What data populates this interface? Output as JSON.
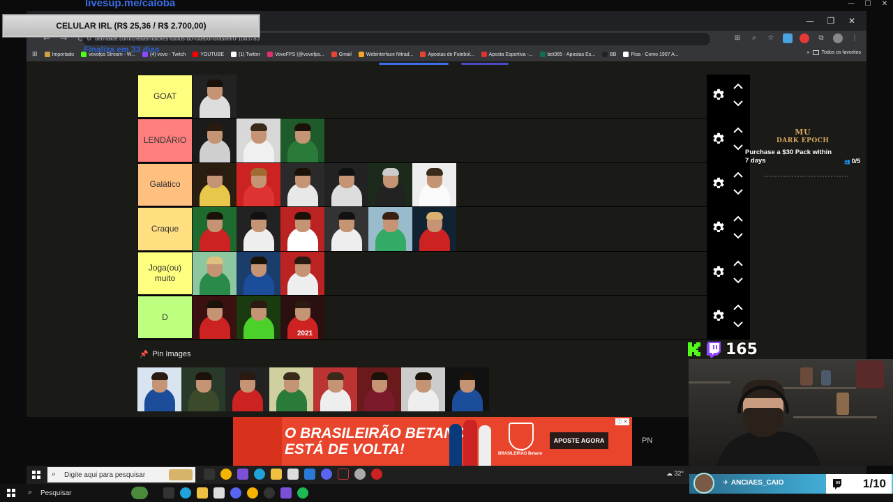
{
  "overlay": {
    "livesup": "livesup.me/caloba",
    "celular": "CELULAR IRL (R$ 25,36 / R$ 2.700,00)",
    "finaliza": "Finaliza em 33 dias",
    "subs_count": "165",
    "chat_user": "ANCIAES_CAIO",
    "page_indicator": "1/10"
  },
  "browser": {
    "url": "tiermaker.com/create/maiores-idolos-do-futebol-brasileiro-1083783",
    "bookmarks": [
      {
        "label": "Importado",
        "color": "#d0a040"
      },
      {
        "label": "vovofps Stream - W...",
        "color": "#53fc18"
      },
      {
        "label": "(4) vovo - Twitch",
        "color": "#9146ff"
      },
      {
        "label": "YOUTUBE",
        "color": "#ff0000"
      },
      {
        "label": "(1) Twitter",
        "color": "#ffffff"
      },
      {
        "label": "VovoFPS (@vovofps...",
        "color": "#e1306c"
      },
      {
        "label": "Gmail",
        "color": "#ea4335"
      },
      {
        "label": "Webinterface Nitrad...",
        "color": "#f5a623"
      },
      {
        "label": "Apostas de Futebol...",
        "color": "#e8452c"
      },
      {
        "label": "Aposta Esportiva -...",
        "color": "#d33"
      },
      {
        "label": "bet365 - Apostas Es...",
        "color": "#126e51"
      },
      {
        "label": "BB",
        "color": "#222"
      },
      {
        "label": "Pisa - Como 1907 A...",
        "color": "#fff"
      }
    ],
    "bookmarks_right": "Todos os favoritos"
  },
  "tiers": [
    {
      "label": "GOAT",
      "color": "#ffff7f",
      "items": [
        [
          "#222",
          "#ddd",
          "#1a1208"
        ]
      ]
    },
    {
      "label": "LENDÁRIO",
      "color": "#ff7f7f",
      "items": [
        [
          "#1b1b1b",
          "#cfcfcf",
          "#2a1a10"
        ],
        [
          "#d8d8d8",
          "#f0f0f0",
          "#3a2a1a"
        ],
        [
          "#1f5a2a",
          "#2a7a3a",
          "#1a1208"
        ]
      ]
    },
    {
      "label": "Galático",
      "color": "#ffbf7f",
      "items": [
        [
          "#2a1e10",
          "#e8c84a",
          "#2a1a10"
        ],
        [
          "#c22",
          "#d33",
          "#a06a30"
        ],
        [
          "#2a2a2a",
          "#e8e8e8",
          "#1a1208"
        ],
        [
          "#222",
          "#ddd",
          "#111"
        ],
        [
          "#1b2a1a",
          "#222",
          "#ccc"
        ],
        [
          "#eee",
          "#fafafa",
          "#3a2a1a"
        ]
      ]
    },
    {
      "label": "Craque",
      "color": "#ffdf7f",
      "items": [
        [
          "#1d6b2d",
          "#c22",
          "#1a1208"
        ],
        [
          "#222",
          "#eee",
          "#111"
        ],
        [
          "#b22",
          "#fff",
          "#1a1208"
        ],
        [
          "#333",
          "#eee",
          "#111"
        ],
        [
          "#9bc",
          "#3a6",
          "#3a2010"
        ],
        [
          "#123",
          "#c22",
          "#d9b070"
        ]
      ]
    },
    {
      "label": "Joga(ou) muito",
      "color": "#ffff7f",
      "items": [
        [
          "#8cc7a0",
          "#2a8a4a",
          "#e0c080"
        ],
        [
          "#1b3d6b",
          "#1b4d9b",
          "#1a1208"
        ],
        [
          "#b22",
          "#eee",
          "#2a1a10"
        ]
      ]
    },
    {
      "label": "D",
      "color": "#bfff7f",
      "items": [
        [
          "#3a1010",
          "#c22",
          "#1a1208"
        ],
        [
          "#1a3a10",
          "#4cd02a",
          "#2a1a10"
        ],
        [
          "#2a1010",
          "#c22",
          "#2a1a10"
        ]
      ]
    }
  ],
  "d_year_label": "2021",
  "pin": {
    "label": "Pin Images",
    "items": [
      [
        "#d8e4f0",
        "#1b4d9b",
        "#2a1a10"
      ],
      [
        "#2a3a2a",
        "#3a4a2a",
        "#1a1208"
      ],
      [
        "#222",
        "#c22",
        "#2a1a10"
      ],
      [
        "#cfcfa0",
        "#2a7a3a",
        "#3a2a1a"
      ],
      [
        "#b33",
        "#eee",
        "#3a2a1a"
      ],
      [
        "#6a1a1a",
        "#7a1a2a",
        "#1a1208"
      ],
      [
        "#ccc",
        "#eee",
        "#1a1208"
      ],
      [
        "#111",
        "#1b4d9b",
        "#1a1208"
      ]
    ]
  },
  "ad": {
    "title_line1": "Purchase a $30 Pack within",
    "title_line2": "7 days",
    "count": "0/5",
    "logo_top": "MU",
    "logo_bottom": "DARK EPOCH"
  },
  "betano": {
    "line1": "O BRASILEIRÃO BETANO",
    "line2": "ESTÁ DE VOLTA!",
    "button": "APOSTE AGORA",
    "badge_text": "BRASILEIRÃO Betano",
    "pn": "PN"
  },
  "taskbar": {
    "search1": "Digite aqui para pesquisar",
    "search2": "Pesquisar",
    "tray_temp": "32°"
  }
}
